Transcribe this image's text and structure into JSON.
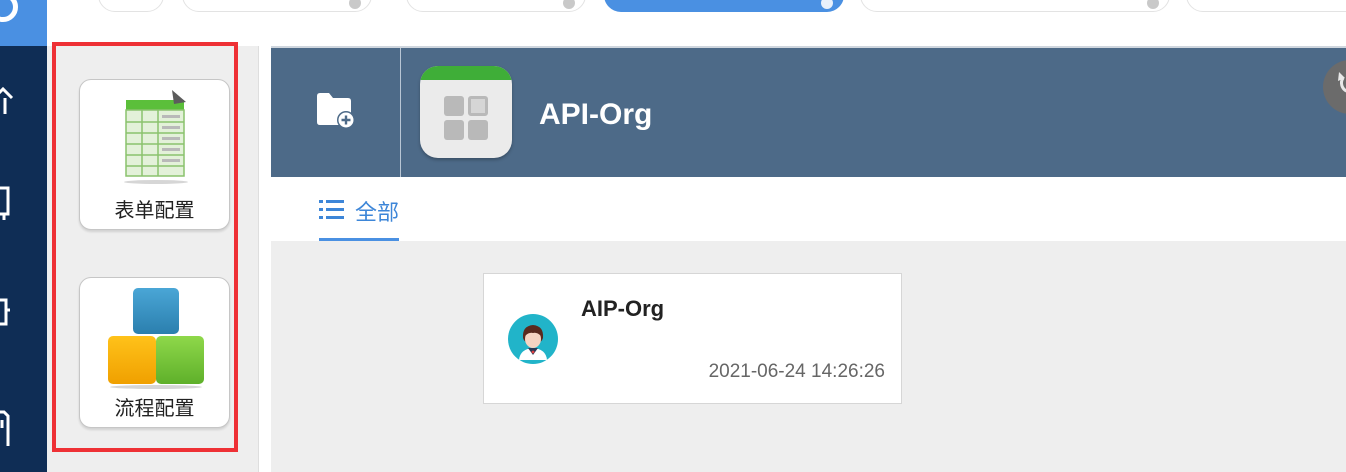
{
  "config_panel": {
    "form_config_label": "表单配置",
    "flow_config_label": "流程配置"
  },
  "header": {
    "app_name": "API-Org",
    "icons": [
      "folder-plus-icon",
      "app-grid-icon",
      "refresh-icon"
    ]
  },
  "filter_tabs": [
    {
      "label": "全部",
      "icon": "list-icon",
      "active": true
    }
  ],
  "records": [
    {
      "title": "AIP-Org",
      "timestamp": "2021-06-24 14:26:26",
      "avatar": "user-avatar-icon"
    }
  ],
  "colors": {
    "nav_dark": "#0f2d55",
    "accent": "#4a90e2",
    "header_bg": "#4d6a88",
    "highlight_frame": "#ee3035"
  }
}
